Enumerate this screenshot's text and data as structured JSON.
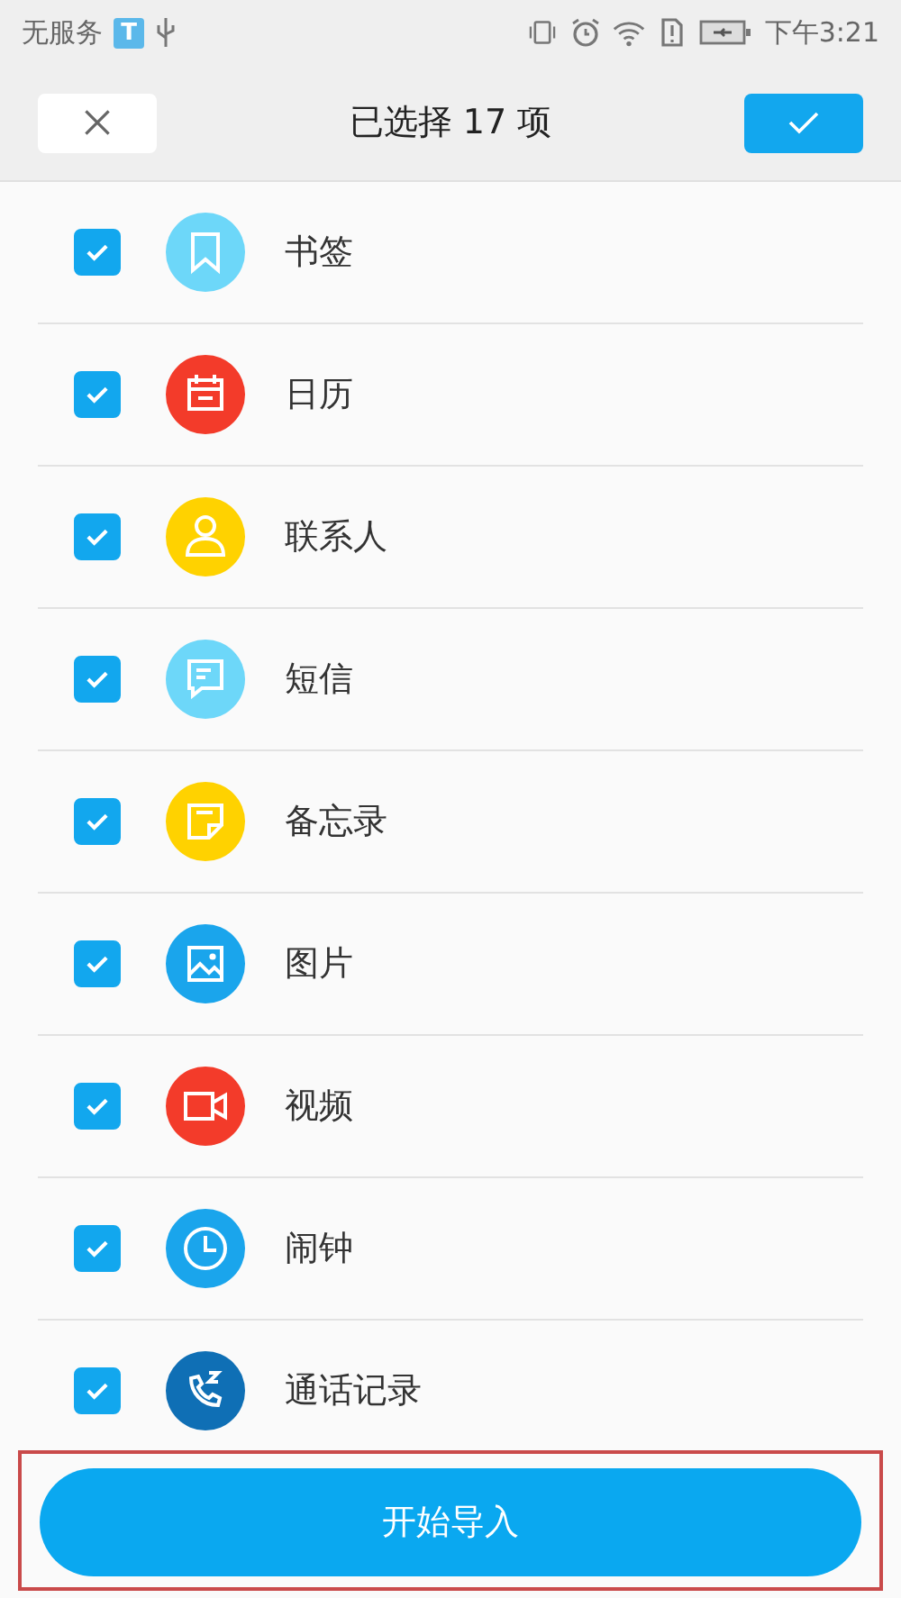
{
  "status_bar": {
    "carrier": "无服务",
    "badge": "T",
    "time": "下午3:21"
  },
  "header": {
    "title": "已选择 17 项"
  },
  "items": [
    {
      "label": "书签",
      "checked": true,
      "kind": "bookmark",
      "color": "#6dd7f9"
    },
    {
      "label": "日历",
      "checked": true,
      "kind": "calendar",
      "color": "#f33b2a"
    },
    {
      "label": "联系人",
      "checked": true,
      "kind": "contact",
      "color": "#ffd200"
    },
    {
      "label": "短信",
      "checked": true,
      "kind": "message",
      "color": "#6dd7f9"
    },
    {
      "label": "备忘录",
      "checked": true,
      "kind": "memo",
      "color": "#ffd200"
    },
    {
      "label": "图片",
      "checked": true,
      "kind": "image",
      "color": "#1aa5ec"
    },
    {
      "label": "视频",
      "checked": true,
      "kind": "video",
      "color": "#f33b2a"
    },
    {
      "label": "闹钟",
      "checked": true,
      "kind": "clock",
      "color": "#1aa5ec"
    },
    {
      "label": "通话记录",
      "checked": true,
      "kind": "calllog",
      "color": "#0f6fb5"
    }
  ],
  "action_button": {
    "label": "开始导入"
  }
}
